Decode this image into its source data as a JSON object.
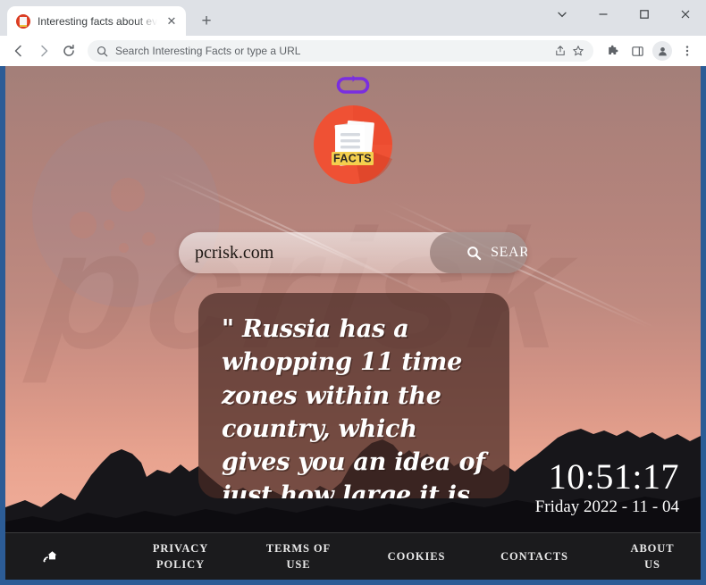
{
  "browser": {
    "tab": {
      "title": "Interesting facts about everything",
      "favicon": "facts-favicon",
      "close": "✕"
    },
    "new_tab": "+",
    "window_controls": {
      "more": "⌄",
      "minimize": "–",
      "maximize": "□",
      "close": "✕"
    },
    "toolbar": {
      "back": "←",
      "forward": "→",
      "reload": "↻",
      "omnibox_placeholder": "Search Interesting Facts or type a URL",
      "search_icon": "search-icon",
      "share_icon": "share-icon",
      "bookmark_icon": "star-icon",
      "extensions_icon": "puzzle-icon",
      "sidepanel_icon": "side-panel-icon",
      "profile_icon": "profile-avatar-icon",
      "menu_icon": "three-dot-menu-icon"
    }
  },
  "page": {
    "loop_icon": "refresh-loop-icon",
    "logo": {
      "name": "facts-logo",
      "label": "FACTS"
    },
    "search": {
      "value": "pcrisk.com",
      "placeholder": "",
      "button_label": "SEARCH",
      "button_icon": "magnifier-icon"
    },
    "quote": {
      "text": "\"  Russia has a whopping 11 time zones within the country, which gives you an idea of just how large it is. \""
    },
    "clock": {
      "time": "10:51:17",
      "date": "Friday 2022 - 11 - 04"
    },
    "footer": {
      "home_icon": "home-signal-icon",
      "links": [
        {
          "line1": "PRIVACY",
          "line2": "POLICY"
        },
        {
          "line1": "TERMS OF",
          "line2": "USE"
        },
        {
          "line1": "COOKIES",
          "line2": ""
        },
        {
          "line1": "CONTACTS",
          "line2": ""
        },
        {
          "line1": "ABOUT",
          "line2": "US"
        }
      ]
    },
    "watermark_text": "pcrisk"
  },
  "colors": {
    "brand_red": "#ef5134",
    "accent_purple": "#7a2ee0",
    "logo_yellow": "#f4cf4e",
    "footer_bg": "#1b1b1d",
    "window_blue": "#2c5c96"
  }
}
